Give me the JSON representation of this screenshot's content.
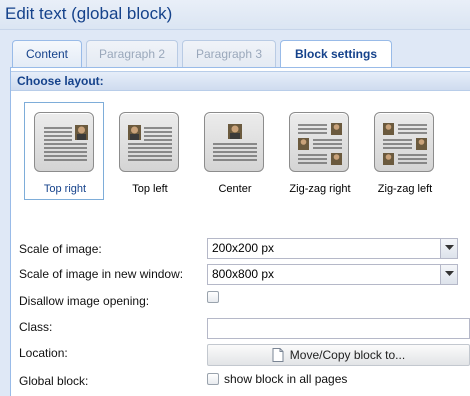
{
  "window": {
    "title": "Edit text (global block)"
  },
  "tabs": [
    {
      "label": "Content",
      "state": "normal"
    },
    {
      "label": "Paragraph 2",
      "state": "disabled"
    },
    {
      "label": "Paragraph 3",
      "state": "disabled"
    },
    {
      "label": "Block settings",
      "state": "active"
    }
  ],
  "layout": {
    "header": "Choose layout:",
    "options": [
      {
        "label": "Top right",
        "icon": "layout-top-right-icon",
        "selected": true
      },
      {
        "label": "Top left",
        "icon": "layout-top-left-icon",
        "selected": false
      },
      {
        "label": "Center",
        "icon": "layout-center-icon",
        "selected": false
      },
      {
        "label": "Zig-zag right",
        "icon": "layout-zigzag-right-icon",
        "selected": false
      },
      {
        "label": "Zig-zag left",
        "icon": "layout-zigzag-left-icon",
        "selected": false
      }
    ]
  },
  "form": {
    "scale_label": "Scale of image:",
    "scale_value": "200x200 px",
    "scale_window_label": "Scale of image in new window:",
    "scale_window_value": "800x800 px",
    "disallow_label": "Disallow image opening:",
    "disallow_checked": false,
    "class_label": "Class:",
    "class_value": "",
    "location_label": "Location:",
    "location_button": "Move/Copy block to...",
    "global_label": "Global block:",
    "global_checkbox_label": "show block in all pages",
    "global_checked": false
  },
  "colors": {
    "accent": "#15428b",
    "panel_border": "#99bbe8",
    "background": "#dfe8f6"
  }
}
